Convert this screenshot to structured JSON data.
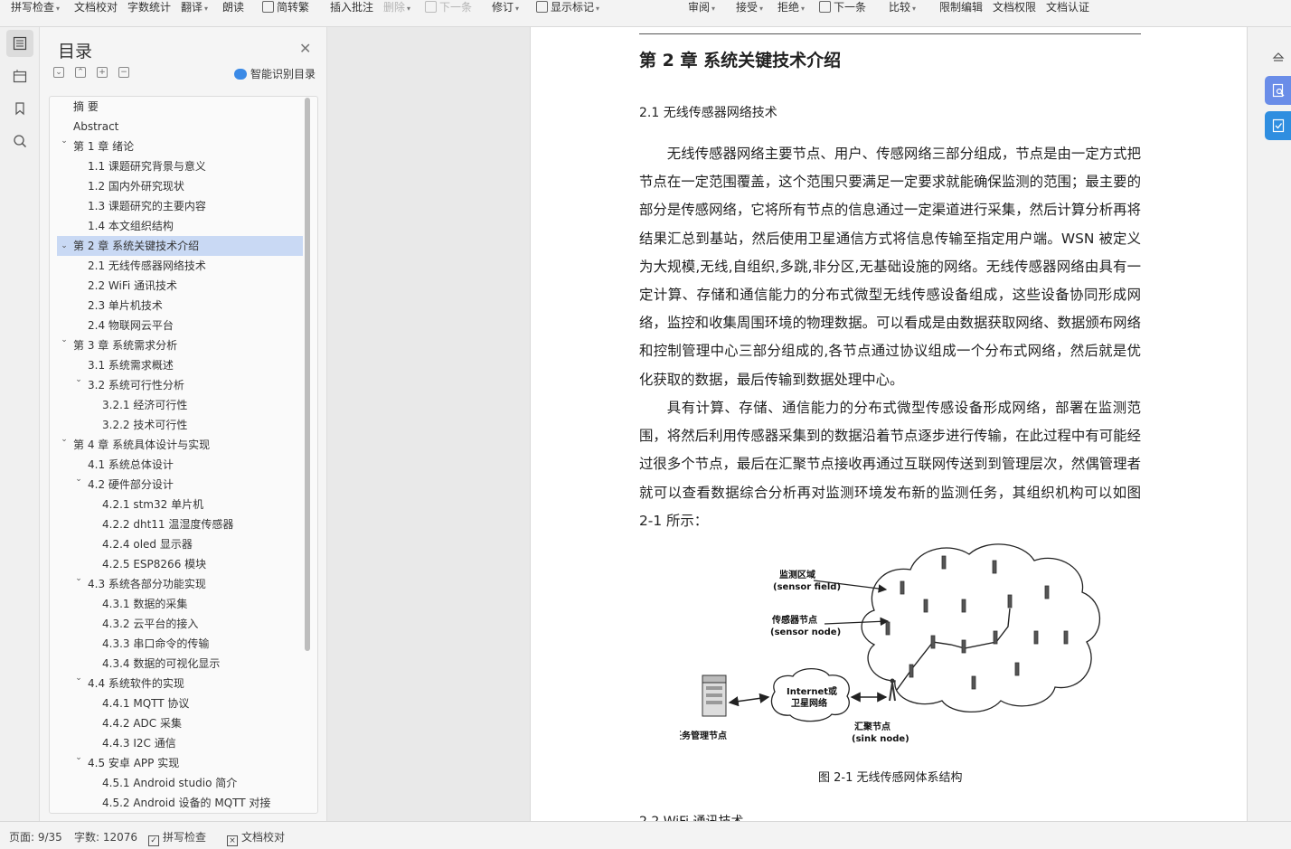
{
  "ribbon": {
    "spell_check": "拼写检查",
    "doc_proof": "文档校对",
    "word_count": "字数统计",
    "translate": "翻译",
    "read_aloud": "朗读",
    "convert": "简转繁",
    "insert_comment": "插入批注",
    "delete": "删除",
    "next_comment": "下一条",
    "revise": "修订",
    "show_markup": "显示标记",
    "review": "审阅",
    "accept": "接受",
    "reject": "拒绝",
    "next_change": "下一条",
    "compare": "比较",
    "restrict_edit": "限制编辑",
    "doc_permission": "文档权限",
    "doc_auth": "文档认证"
  },
  "toc": {
    "title": "目录",
    "smart_label": "智能识别目录",
    "items": [
      {
        "label": "摘  要"
      },
      {
        "label": "Abstract"
      },
      {
        "label": "第 1 章  绪论"
      },
      {
        "label": "1.1  课题研究背景与意义"
      },
      {
        "label": "1.2  国内外研究现状"
      },
      {
        "label": "1.3  课题研究的主要内容"
      },
      {
        "label": "1.4  本文组织结构"
      },
      {
        "label": "第 2 章  系统关键技术介绍"
      },
      {
        "label": "2.1  无线传感器网络技术"
      },
      {
        "label": "2.2 WiFi 通讯技术"
      },
      {
        "label": "2.3  单片机技术"
      },
      {
        "label": "2.4  物联网云平台"
      },
      {
        "label": "第 3 章  系统需求分析"
      },
      {
        "label": "3.1  系统需求概述"
      },
      {
        "label": "3.2  系统可行性分析"
      },
      {
        "label": "3.2.1  经济可行性"
      },
      {
        "label": "3.2.2  技术可行性"
      },
      {
        "label": "第 4 章  系统具体设计与实现"
      },
      {
        "label": "4.1  系统总体设计"
      },
      {
        "label": "4.2  硬件部分设计"
      },
      {
        "label": "4.2.1 stm32 单片机"
      },
      {
        "label": "4.2.2 dht11 温湿度传感器"
      },
      {
        "label": "4.2.4 oled 显示器"
      },
      {
        "label": "4.2.5 ESP8266 模块"
      },
      {
        "label": "4.3  系统各部分功能实现"
      },
      {
        "label": "4.3.1 数据的采集"
      },
      {
        "label": "4.3.2 云平台的接入"
      },
      {
        "label": "4.3.3  串口命令的传输"
      },
      {
        "label": "4.3.4 数据的可视化显示"
      },
      {
        "label": "4.4  系统软件的实现"
      },
      {
        "label": "4.4.1 MQTT 协议"
      },
      {
        "label": "4.4.2 ADC 采集"
      },
      {
        "label": "4.4.3 I2C 通信"
      },
      {
        "label": "4.5  安卓 APP 实现"
      },
      {
        "label": "4.5.1    Android studio 简介"
      },
      {
        "label": "4.5.2 Android 设备的 MQTT 对接"
      }
    ]
  },
  "doc": {
    "chapter_title": "第 2 章  系统关键技术介绍",
    "section_title": "2.1  无线传感器网络技术",
    "para1": "无线传感器网络主要节点、用户、传感网络三部分组成，节点是由一定方式把节点在一定范围覆盖，这个范围只要满足一定要求就能确保监测的范围；最主要的部分是传感网络，它将所有节点的信息通过一定渠道进行采集，然后计算分析再将结果汇总到基站，然后使用卫星通信方式将信息传输至指定用户端。WSN 被定义为大规模,无线,自组织,多跳,非分区,无基础设施的网络。无线传感器网络由具有一定计算、存储和通信能力的分布式微型无线传感设备组成，这些设备协同形成网络，监控和收集周围环境的物理数据。可以看成是由数据获取网络、数据颁布网络和控制管理中心三部分组成的,各节点通过协议组成一个分布式网络，然后就是优化获取的数据，最后传输到数据处理中心。",
    "para2": "具有计算、存储、通信能力的分布式微型传感设备形成网络，部署在监测范围，将然后利用传感器采集到的数据沿着节点逐步进行传输，在此过程中有可能经过很多个节点，最后在汇聚节点接收再通过互联网传送到到管理层次，然偶管理者就可以查看数据综合分析再对监测环境发布新的监测任务，其组织机构可以如图 2-1 所示：",
    "figure": {
      "field_cn": "监测区域",
      "field_en": "(sensor field)",
      "node_cn": "传感器节点",
      "node_en": "(sensor node)",
      "internet_l1": "Internet或",
      "internet_l2": "卫星网络",
      "sink_cn": "汇聚节点",
      "sink_en": "(sink node)",
      "manager": "任务管理节点"
    },
    "caption": "图 2-1  无线传感网体系结构",
    "next_section": "2.2 WiFi 通讯技术"
  },
  "status": {
    "page": "页面: 9/35",
    "words": "字数: 12076",
    "spell": "拼写检查",
    "proof": "文档校对"
  }
}
